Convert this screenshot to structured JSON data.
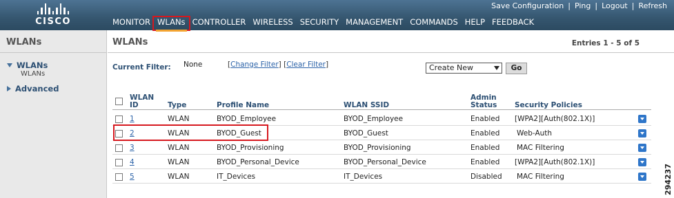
{
  "header": {
    "logo_text": "CISCO",
    "utility_links": [
      "Save Configuration",
      "Ping",
      "Logout",
      "Refresh"
    ],
    "nav": [
      "MONITOR",
      "WLANs",
      "CONTROLLER",
      "WIRELESS",
      "SECURITY",
      "MANAGEMENT",
      "COMMANDS",
      "HELP",
      "FEEDBACK"
    ],
    "active_nav": "WLANs"
  },
  "sidebar": {
    "title": "WLANs",
    "items": [
      {
        "label": "WLANs",
        "expanded": true,
        "children": [
          "WLANs"
        ]
      },
      {
        "label": "Advanced",
        "expanded": false,
        "children": []
      }
    ]
  },
  "main": {
    "title": "WLANs",
    "entries": "Entries 1 - 5 of 5",
    "filter_label": "Current Filter:",
    "filter_value": "None",
    "change_filter": "Change Filter",
    "clear_filter": "Clear Filter",
    "action_select": "Create New",
    "go_button": "Go",
    "columns": [
      "WLAN ID",
      "Type",
      "Profile Name",
      "WLAN SSID",
      "Admin Status",
      "Security Policies"
    ],
    "rows": [
      {
        "id": "1",
        "type": "WLAN",
        "profile": "BYOD_Employee",
        "ssid": "BYOD_Employee",
        "status": "Enabled",
        "security": "[WPA2][Auth(802.1X)]"
      },
      {
        "id": "2",
        "type": "WLAN",
        "profile": "BYOD_Guest",
        "ssid": "BYOD_Guest",
        "status": "Enabled",
        "security": "Web-Auth"
      },
      {
        "id": "3",
        "type": "WLAN",
        "profile": "BYOD_Provisioning",
        "ssid": "BYOD_Provisioning",
        "status": "Enabled",
        "security": "MAC Filtering"
      },
      {
        "id": "4",
        "type": "WLAN",
        "profile": "BYOD_Personal_Device",
        "ssid": "BYOD_Personal_Device",
        "status": "Enabled",
        "security": "[WPA2][Auth(802.1X)]"
      },
      {
        "id": "5",
        "type": "WLAN",
        "profile": "IT_Devices",
        "ssid": "IT_Devices",
        "status": "Disabled",
        "security": "MAC Filtering"
      }
    ]
  },
  "figure_number": "294237",
  "colors": {
    "header": "#35566f",
    "highlight": "#d6181e",
    "link": "#2c63a8",
    "label": "#2c4f73"
  }
}
